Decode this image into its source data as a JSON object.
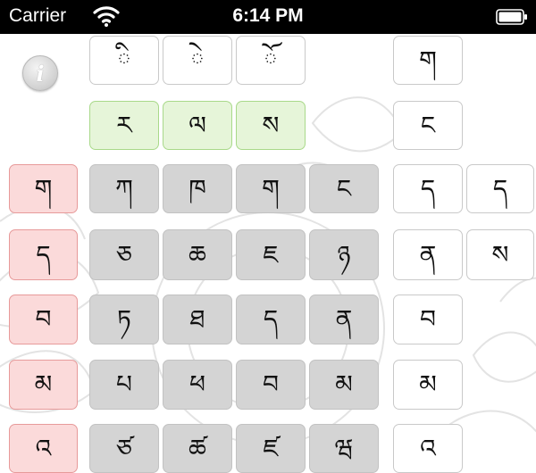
{
  "status_bar": {
    "carrier": "Carrier",
    "time": "6:14 PM"
  },
  "info_button": {
    "label": "i"
  },
  "vowel_row": [
    "ི",
    "ེ",
    "ོ"
  ],
  "head_letters": [
    "ར",
    "ལ",
    "ས"
  ],
  "prefix_letters": [
    "ག",
    "ད",
    "བ",
    "མ",
    "འ"
  ],
  "root_grid": [
    [
      "ཀ",
      "ཁ",
      "ག",
      "ང"
    ],
    [
      "ཅ",
      "ཆ",
      "ཇ",
      "ཉ"
    ],
    [
      "ཏ",
      "ཐ",
      "ད",
      "ན"
    ],
    [
      "པ",
      "ཕ",
      "བ",
      "མ"
    ],
    [
      "ཙ",
      "ཚ",
      "ཛ",
      "ཝ"
    ]
  ],
  "suffix_letters": [
    "ག",
    "ང",
    "ད",
    "ན",
    "བ",
    "མ",
    "འ"
  ],
  "post_suffix_letters": [
    "ད",
    "ས"
  ]
}
